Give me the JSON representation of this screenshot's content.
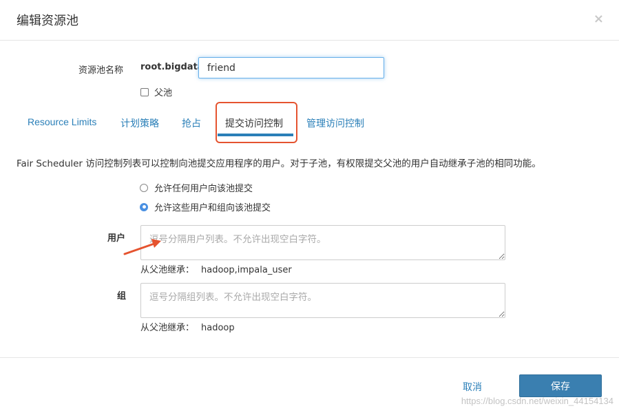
{
  "dialog": {
    "title": "编辑资源池",
    "close_icon": "close-icon ×"
  },
  "pool": {
    "name_label": "资源池名称",
    "prefix": "root.bigdata.",
    "name_value": "friend",
    "parent_checkbox_label": "父池",
    "parent_checked": false
  },
  "tabs": [
    {
      "label": "Resource Limits",
      "active": false
    },
    {
      "label": "计划策略",
      "active": false
    },
    {
      "label": "抢占",
      "active": false
    },
    {
      "label": "提交访问控制",
      "active": true
    },
    {
      "label": "管理访问控制",
      "active": false
    }
  ],
  "access": {
    "description": "Fair Scheduler 访问控制列表可以控制向池提交应用程序的用户。对于子池，有权限提交父池的用户自动继承子池的相同功能。",
    "radio_any": "允许任何用户向该池提交",
    "radio_specific": "允许这些用户和组向该池提交",
    "selected": "radio_specific",
    "users_label": "用户",
    "users_placeholder": "逗号分隔用户列表。不允许出现空白字符。",
    "users_inherit_label": "从父池继承：",
    "users_inherit_value": "hadoop,impala_user",
    "groups_label": "组",
    "groups_placeholder": "逗号分隔组列表。不允许出现空白字符。",
    "groups_inherit_label": "从父池继承：",
    "groups_inherit_value": "hadoop"
  },
  "footer": {
    "cancel_label": "取消",
    "save_label": "保存"
  },
  "watermark": "https://blog.csdn.net/weixin_44154134",
  "colors": {
    "link": "#2a7fb8",
    "primary_button": "#3a7fb0",
    "radio_checked": "#4a90e2",
    "annotation": "#e5532f"
  }
}
